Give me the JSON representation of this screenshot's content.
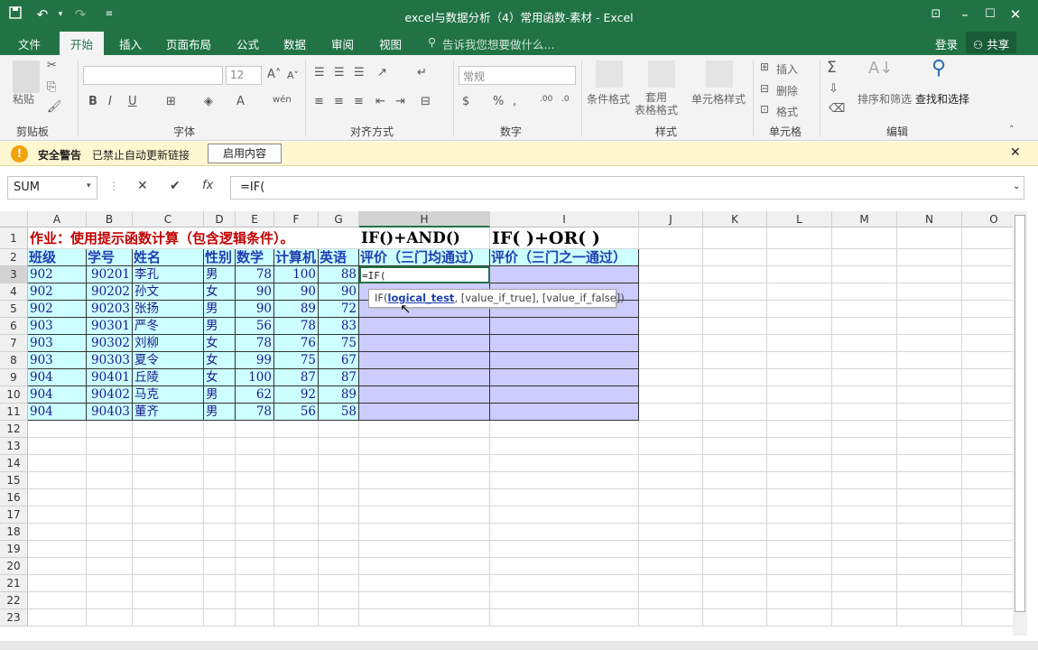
{
  "window": {
    "title": "excel与数据分析（4）常用函数-素材 - Excel"
  },
  "quick_access": {
    "save_icon": "save-icon",
    "undo_icon": "undo-icon",
    "redo_icon": "redo-icon",
    "customize_icon": "customize-icon"
  },
  "tabs": [
    "文件",
    "开始",
    "插入",
    "页面布局",
    "公式",
    "数据",
    "审阅",
    "视图"
  ],
  "tell_me": "告诉我您想要做什么...",
  "account": {
    "login": "登录",
    "share": "共享"
  },
  "ribbon": {
    "groups": [
      "剪贴板",
      "字体",
      "对齐方式",
      "数字",
      "样式",
      "单元格",
      "编辑"
    ],
    "paste": "粘贴",
    "font_size": "12",
    "number_format": "常规",
    "styles": [
      "条件格式",
      "套用\n表格格式",
      "单元格样式"
    ],
    "cells": [
      "插入",
      "删除",
      "格式"
    ],
    "editing": [
      "排序和筛选",
      "查找和选择"
    ],
    "bold": "B",
    "italic": "I",
    "underline": "U",
    "percent": "%"
  },
  "security_bar": {
    "label": "安全警告",
    "message": "已禁止自动更新链接",
    "button": "启用内容"
  },
  "formula_bar": {
    "name_box": "SUM",
    "formula": "=IF("
  },
  "columns": [
    "A",
    "B",
    "C",
    "D",
    "E",
    "F",
    "G",
    "H",
    "I",
    "J",
    "K",
    "L",
    "M",
    "N",
    "O"
  ],
  "rows": [
    "1",
    "2",
    "3",
    "4",
    "5",
    "6",
    "7",
    "8",
    "9",
    "10",
    "11",
    "12",
    "13",
    "14",
    "15",
    "16",
    "17",
    "18",
    "19",
    "20",
    "21",
    "22",
    "23"
  ],
  "sheet": {
    "title": "作业：使用提示函数计算（包含逻辑条件）。",
    "h1": "IF()+AND()",
    "i1": "IF( )+OR( )",
    "headers": [
      "班级",
      "学号",
      "姓名",
      "性别",
      "数学",
      "计算机",
      "英语",
      "评价（三门均通过）",
      "评价（三门之一通过）"
    ],
    "records": [
      [
        "902",
        "90201",
        "李孔",
        "男",
        "78",
        "100",
        "88"
      ],
      [
        "902",
        "90202",
        "孙文",
        "女",
        "90",
        "90",
        "90"
      ],
      [
        "902",
        "90203",
        "张扬",
        "男",
        "90",
        "89",
        "72"
      ],
      [
        "903",
        "90301",
        "严冬",
        "男",
        "56",
        "78",
        "83"
      ],
      [
        "903",
        "90302",
        "刘柳",
        "女",
        "78",
        "76",
        "75"
      ],
      [
        "903",
        "90303",
        "夏令",
        "女",
        "99",
        "75",
        "67"
      ],
      [
        "904",
        "90401",
        "丘陵",
        "女",
        "100",
        "87",
        "87"
      ],
      [
        "904",
        "90402",
        "马克",
        "男",
        "62",
        "92",
        "89"
      ],
      [
        "904",
        "90403",
        "董齐",
        "男",
        "78",
        "56",
        "58"
      ]
    ],
    "editing_cell": "=IF("
  },
  "tooltip": {
    "fn": "IF(",
    "arg1": "logical_test",
    "rest": ", [value_if_true], [value_if_false])"
  },
  "colors": {
    "accent": "#217346",
    "cyan_fill": "#ccffff",
    "purple_fill": "#ccccff",
    "title_red": "#c00000"
  }
}
